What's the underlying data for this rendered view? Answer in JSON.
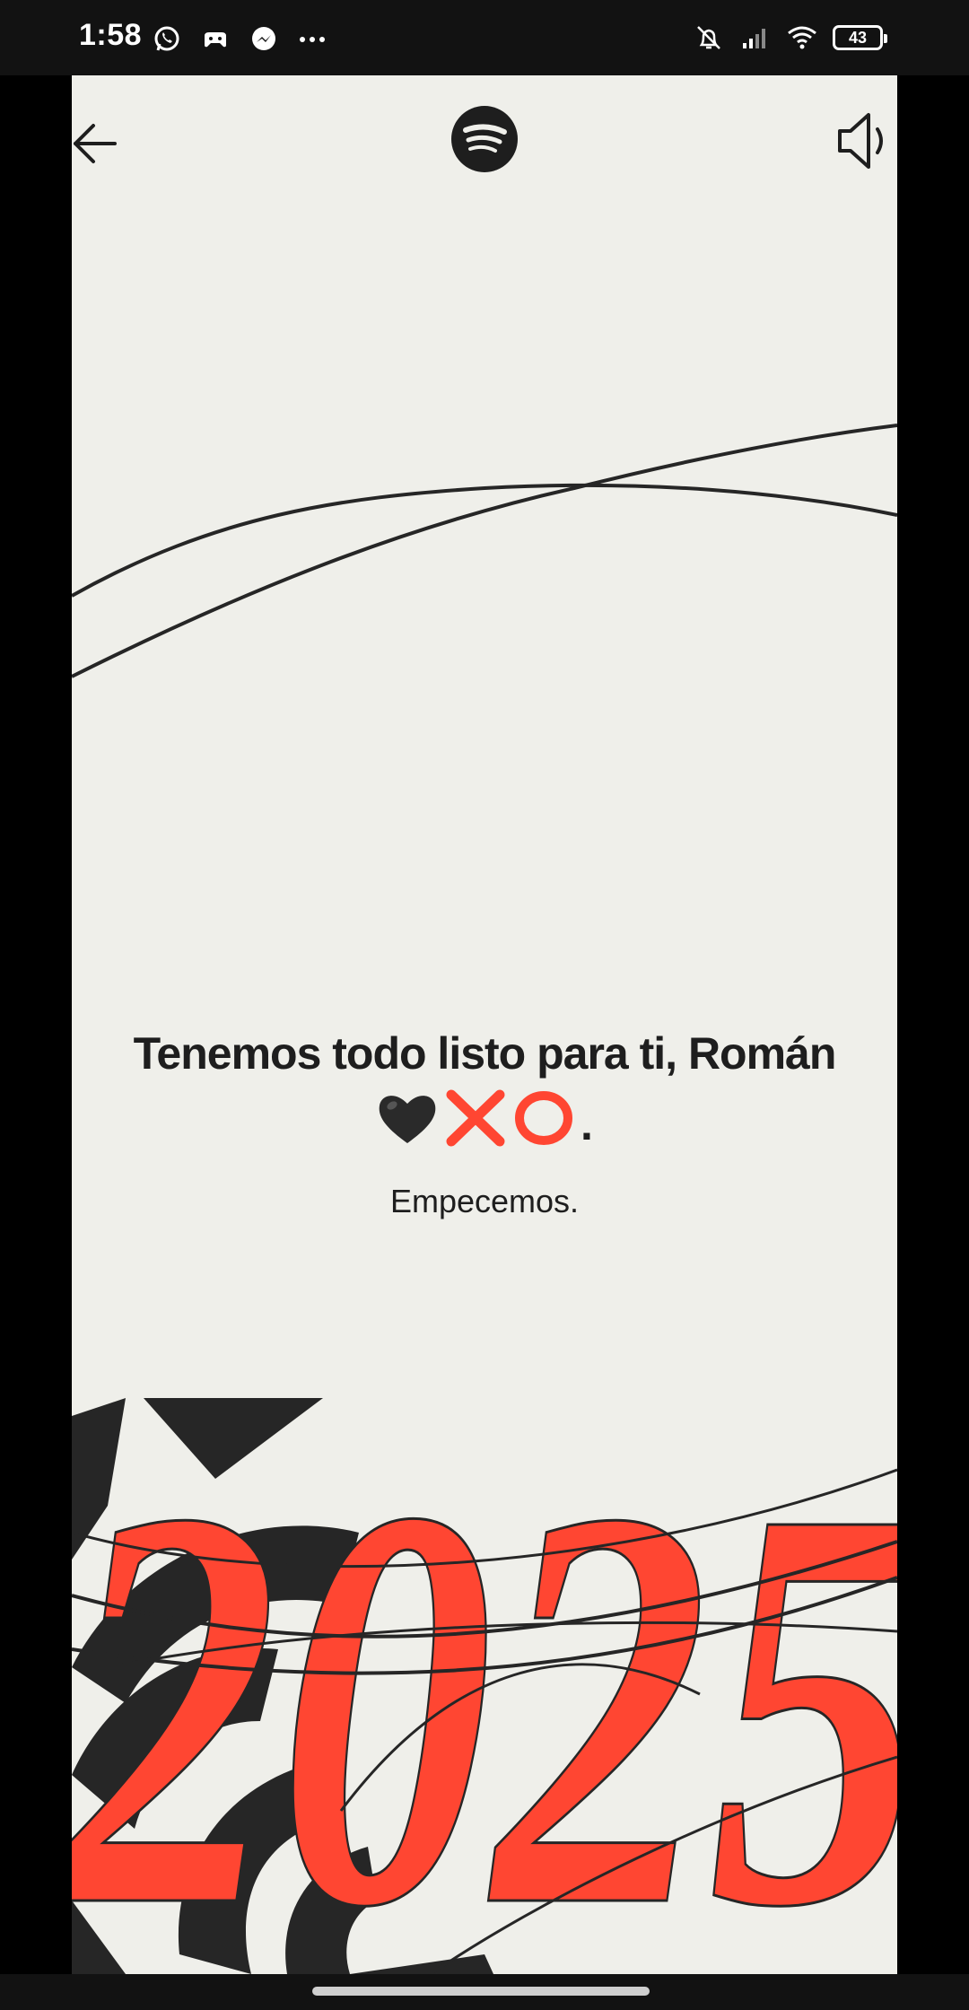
{
  "status_bar": {
    "time": "1:58",
    "battery": "43",
    "left_icons": [
      "whatsapp-icon",
      "game-controller-icon",
      "messenger-icon",
      "more-dots-icon"
    ],
    "right_icons": [
      "bell-off-icon",
      "signal-icon",
      "wifi-icon",
      "battery-icon"
    ]
  },
  "top_bar": {
    "back_icon": "arrow-left-icon",
    "logo_icon": "spotify-logo-icon",
    "sound_icon": "speaker-icon"
  },
  "message": {
    "headline": "Tenemos todo listo para ti, Román",
    "emoji_icons": [
      "black-heart-icon",
      "cross-mark-icon",
      "hollow-circle-icon"
    ],
    "emoji_trail": ".",
    "subline": "Empecemos."
  },
  "art": {
    "year_text": "2025",
    "accent_color": "#ff4632",
    "ink_color": "#262626",
    "background_color": "#efefea"
  }
}
